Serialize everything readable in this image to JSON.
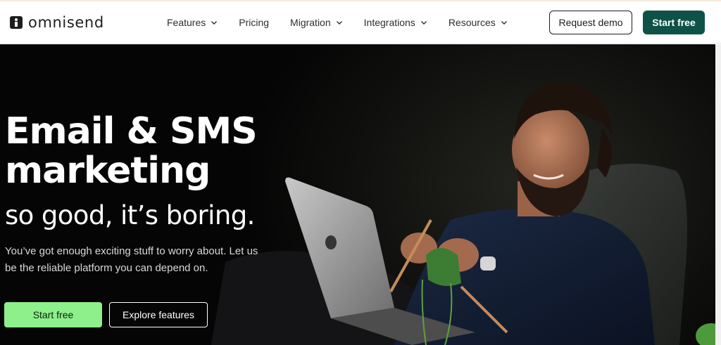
{
  "brand": {
    "name": "omnisend",
    "logo_icon": "omnisend-logo-icon"
  },
  "nav": {
    "items": [
      {
        "label": "Features",
        "has_dropdown": true
      },
      {
        "label": "Pricing",
        "has_dropdown": false
      },
      {
        "label": "Migration",
        "has_dropdown": true
      },
      {
        "label": "Integrations",
        "has_dropdown": true
      },
      {
        "label": "Resources",
        "has_dropdown": true
      }
    ],
    "request_demo_label": "Request demo",
    "start_free_label": "Start free"
  },
  "hero": {
    "headline_line1": "Email & SMS",
    "headline_line2": "marketing",
    "subline": "so good, it’s boring.",
    "description": "You’ve got enough exciting stuff to worry about. Let us be the reliable platform you can depend on.",
    "start_free_label": "Start free",
    "explore_label": "Explore features"
  },
  "colors": {
    "brand_dark_green": "#0e5247",
    "accent_green": "#8df08a",
    "hero_background": "#050505"
  }
}
